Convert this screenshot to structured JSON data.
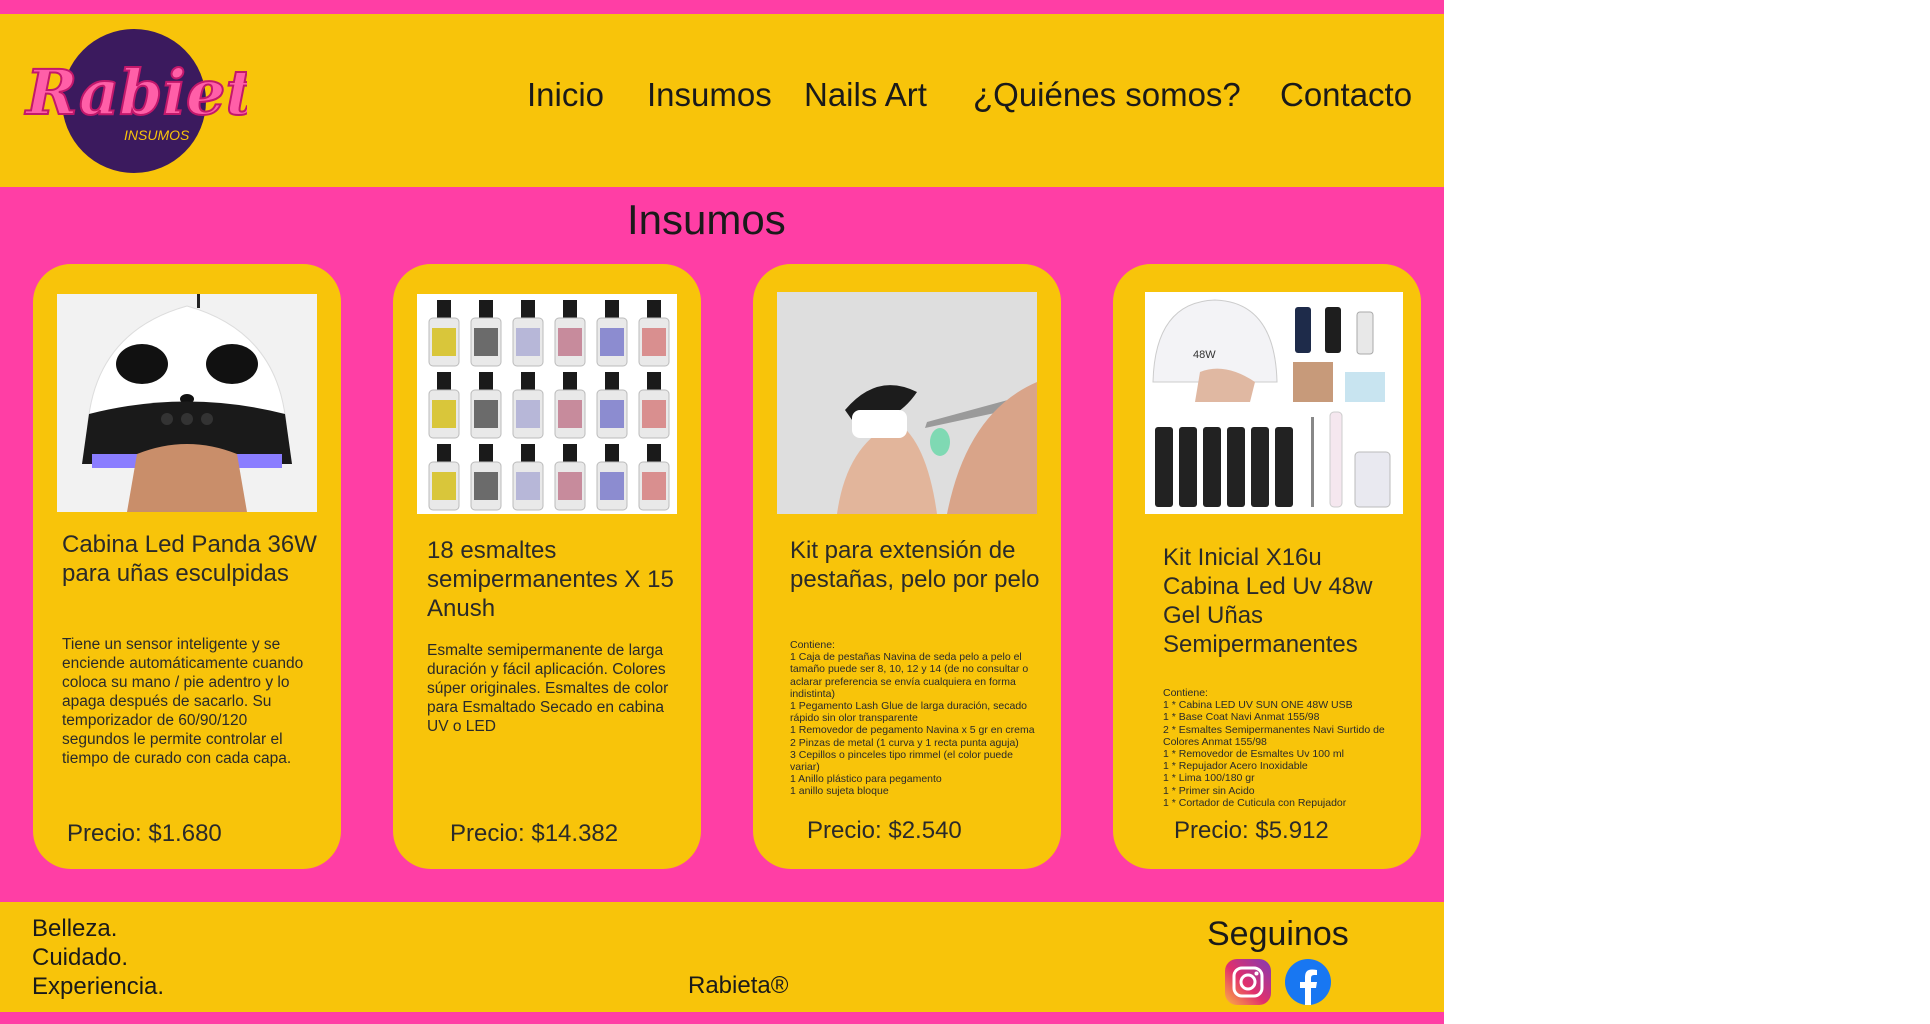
{
  "brand": {
    "logo_text": "Rabieta",
    "logo_subtext": "INSUMOS",
    "colors": {
      "pink": "#ff3ea5",
      "yellow": "#f8c40a",
      "purple": "#3b1a5e"
    }
  },
  "nav": [
    "Inicio",
    "Insumos",
    "Nails Art",
    "¿Quiénes somos?",
    "Contacto"
  ],
  "section_title": "Insumos",
  "products": [
    {
      "title": "Cabina Led Panda 36W para uñas esculpidas",
      "description": "Tiene un sensor inteligente y se enciende automáticamente cuando coloca su mano / pie adentro y lo apaga después de sacarlo. Su temporizador de 60/90/120 segundos le permite controlar el tiempo de curado con cada capa.",
      "price": "Precio: $1.680",
      "image": "panda-uv-led-lamp"
    },
    {
      "title": "18 esmaltes semipermanentes X 15 Anush",
      "description": "Esmalte semipermanente de larga duración y fácil aplicación. Colores súper originales. Esmaltes de color para Esmaltado Secado en cabina UV o LED",
      "price": "Precio: $14.382",
      "image": "nail-polish-bottles-grid"
    },
    {
      "title": "Kit para extensión de pestañas, pelo por pelo",
      "description": "Contiene:\n1 Caja de pestañas Navina de seda pelo a pelo el tamaño puede ser 8, 10, 12 y 14 (de no consultar o aclarar preferencia se envía cualquiera en forma indistinta)\n1 Pegamento Lash Glue de larga duración, secado rápido sin olor transparente\n1 Removedor de pegamento Navina x 5 gr en crema\n2 Pinzas de metal (1 curva y 1 recta punta aguja)\n3 Cepillos o pinceles tipo rimmel (el color puede variar)\n1 Anillo plástico para pegamento\n1 anillo sujeta bloque",
      "price": "Precio: $2.540",
      "image": "eyelash-extension-tweezers"
    },
    {
      "title": "Kit Inicial X16u Cabina Led Uv 48w Gel Uñas Semipermanentes",
      "description": "Contiene:\n1 * Cabina LED UV SUN ONE 48W USB\n1 * Base Coat Navi Anmat 155/98\n2 * Esmaltes Semipermanentes Navi Surtido de Colores Anmat 155/98\n1 * Removedor de Esmaltes Uv 100 ml\n1 * Repujador Acero Inoxidable\n1 * Lima 100/180 gr\n1 * Primer sin Acido\n1 * Cortador de Cuticula con Repujador",
      "price": "Precio: $5.912",
      "image": "starter-kit-48w-lamp"
    }
  ],
  "footer": {
    "tagline": [
      "Belleza.",
      "Cuidado.",
      "Experiencia."
    ],
    "brand": "Rabieta®",
    "follow_label": "Seguinos",
    "social": [
      "instagram-icon",
      "facebook-icon"
    ]
  }
}
